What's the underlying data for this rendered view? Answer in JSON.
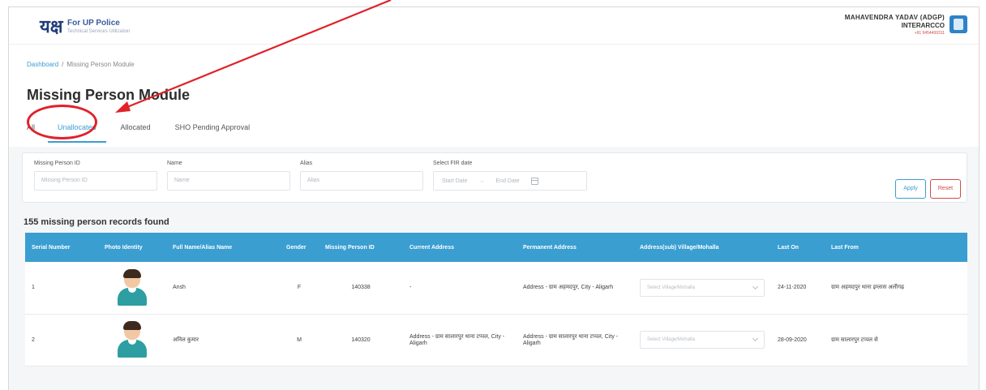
{
  "header": {
    "logo_title": "For UP Police",
    "logo_sub": "Technical Services Utilization",
    "user_name": "MAHAVENDRA YADAV (ADGP)",
    "user_role": "INTERARCCO",
    "user_sub": "+91 9454400311"
  },
  "breadcrumb": {
    "home": "Dashboard",
    "separator": "/",
    "current": "Missing Person Module"
  },
  "page_title": "Missing Person Module",
  "tabs": [
    {
      "label": "All"
    },
    {
      "label": "Unallocated"
    },
    {
      "label": "Allocated"
    },
    {
      "label": "SHO Pending Approval"
    }
  ],
  "filters": {
    "missing_id_label": "Missing Person ID",
    "missing_id_placeholder": "Missing Person ID",
    "name_label": "Name",
    "name_placeholder": "Name",
    "alias_label": "Alias",
    "alias_placeholder": "Alias",
    "fir_date_label": "Select FIR date",
    "fir_start_placeholder": "Start Date",
    "fir_separator": "→",
    "fir_end_placeholder": "End Date",
    "apply_label": "Apply",
    "reset_label": "Reset"
  },
  "records_text": "155 missing person records found",
  "table": {
    "headers": [
      "Serial Number",
      "Photo Identity",
      "Full Name/Alias Name",
      "Gender",
      "Missing Person ID",
      "Current Address",
      "Permanent Address",
      "Address(sub) Village/Mohalla",
      "Last On",
      "Last From"
    ],
    "rows": [
      {
        "serial": "1",
        "name": "Ansh",
        "gender": "F",
        "missing_id": "140338",
        "current_address": "-",
        "permanent_address": "Address - ग्राम अहमदपुर, City - Aligarh",
        "village_placeholder": "Select Village/Mohalla",
        "last_on": "24-11-2020",
        "last_from": "ग्राम अहमदपुर थाना इग्लास अलीगढ़"
      },
      {
        "serial": "2",
        "name": "अनिल कुमार",
        "gender": "M",
        "missing_id": "140320",
        "current_address": "Address - ग्राम सालारपुर थाना टप्पल, City - Aligarh",
        "permanent_address": "Address - ग्राम सालारपुर थाना टप्पल, City - Aligarh",
        "village_placeholder": "Select Village/Mohalla",
        "last_on": "28-09-2020",
        "last_from": "ग्राम सालारपुर टप्पल से"
      }
    ]
  },
  "colors": {
    "accent": "#3a9ed1",
    "annotation": "#e0222a",
    "danger": "#d24a4a"
  }
}
